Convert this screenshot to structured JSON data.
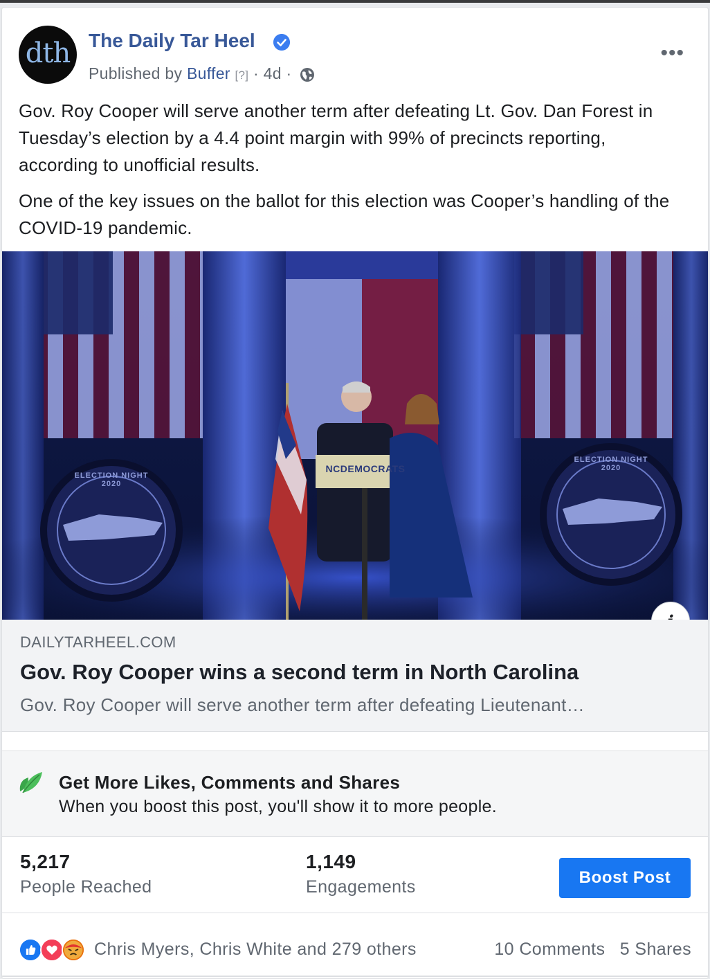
{
  "post": {
    "page_name": "The Daily Tar Heel",
    "avatar_text": "dth",
    "published_prefix": "Published by",
    "publisher": "Buffer",
    "help_marker": "[?]",
    "separator1": "·",
    "time_ago": "4d",
    "separator2": "·",
    "text_paragraphs": [
      "Gov. Roy Cooper will serve another term after defeating Lt. Gov. Dan Forest in Tuesday’s election by a 4.4 point margin with 99% of precincts reporting, according to unofficial results.",
      "One of the key issues on the ballot for this election was Cooper’s handling of the COVID-19 pandemic."
    ],
    "more_icon": "•••"
  },
  "photo": {
    "podium_sign": "NCDEMOCRATS",
    "seal_text": "ELECTION NIGHT 2020"
  },
  "link_preview": {
    "domain": "DAILYTARHEEL.COM",
    "title": "Gov. Roy Cooper wins a second term in North Carolina",
    "description": "Gov. Roy Cooper will serve another term after defeating Lieutenant…",
    "info_icon": "i"
  },
  "boost_promo": {
    "title": "Get More Likes, Comments and Shares",
    "subtitle": "When you boost this post, you'll show it to more people."
  },
  "stats": {
    "reach_value": "5,217",
    "reach_label": "People Reached",
    "engagements_value": "1,149",
    "engagements_label": "Engagements",
    "boost_button": "Boost Post"
  },
  "reactions": {
    "icons": [
      "like-icon",
      "love-icon",
      "angry-icon"
    ],
    "names": "Chris Myers, Chris White and 279 others",
    "comments": "10 Comments",
    "shares": "5 Shares"
  },
  "colors": {
    "link_blue": "#385898",
    "button_blue": "#1877f2",
    "muted_text": "#606770"
  }
}
